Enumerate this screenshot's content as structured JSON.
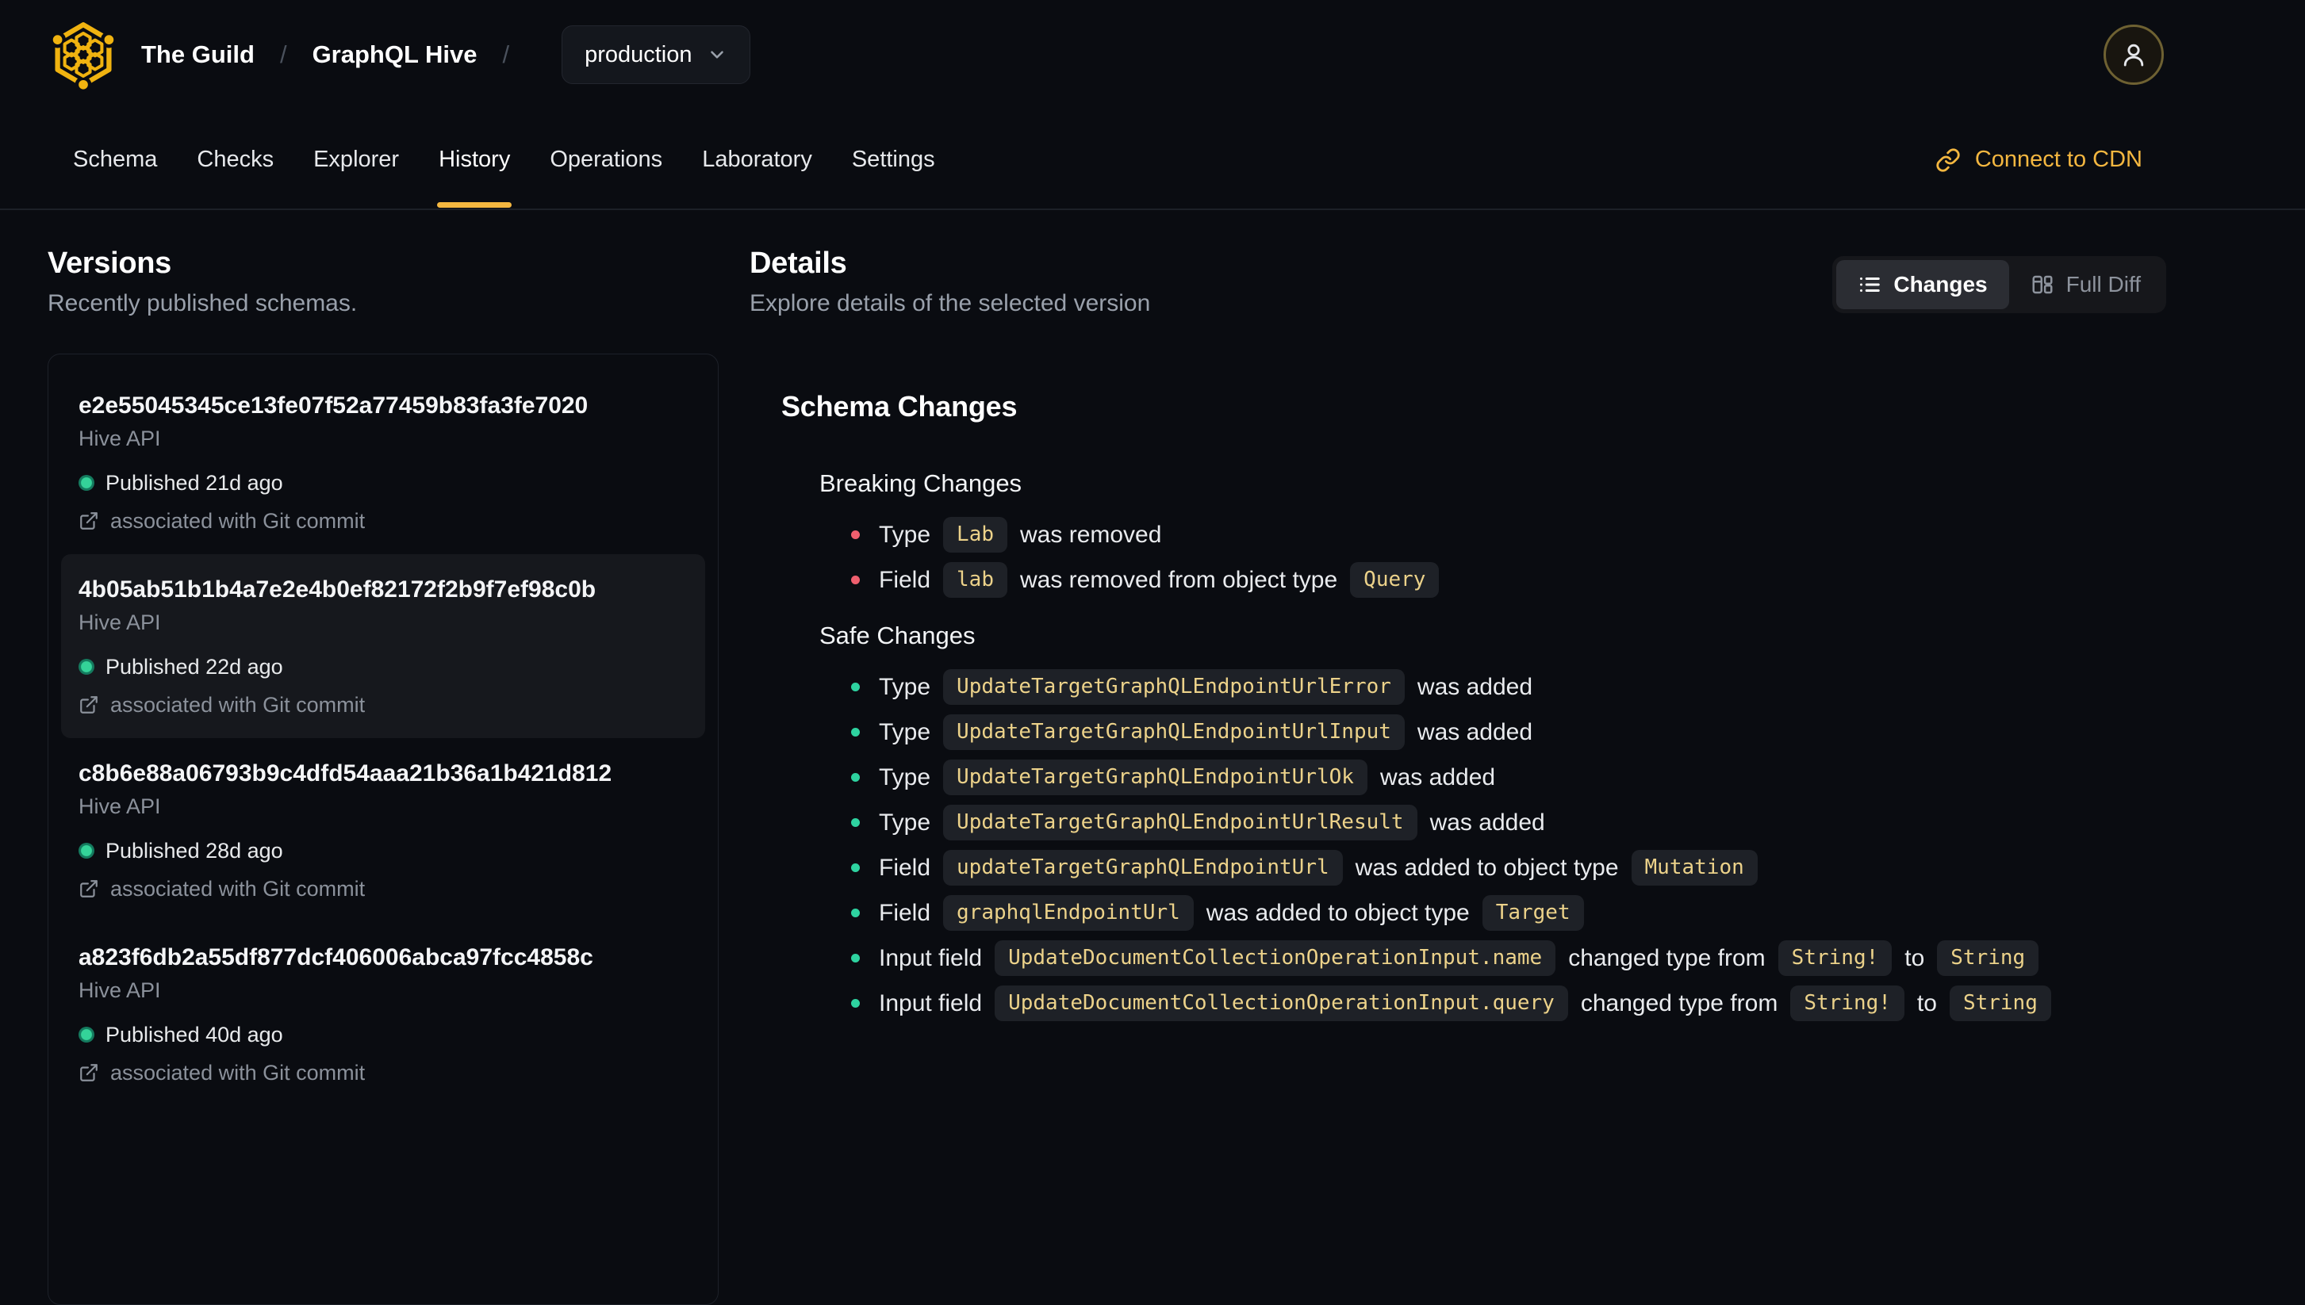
{
  "header": {
    "breadcrumb": {
      "org": "The Guild",
      "separator": "/",
      "project": "GraphQL Hive",
      "target_value": "production"
    },
    "connect_cdn_label": "Connect to CDN"
  },
  "nav": {
    "tabs": [
      "Schema",
      "Checks",
      "Explorer",
      "History",
      "Operations",
      "Laboratory",
      "Settings"
    ],
    "active_tab": "History"
  },
  "versions_panel": {
    "title": "Versions",
    "subtitle": "Recently published schemas.",
    "items": [
      {
        "hash": "e2e55045345ce13fe07f52a77459b83fa3fe7020",
        "service": "Hive API",
        "published": "Published 21d ago",
        "git_link": "associated with Git commit",
        "selected": false
      },
      {
        "hash": "4b05ab51b1b4a7e2e4b0ef82172f2b9f7ef98c0b",
        "service": "Hive API",
        "published": "Published 22d ago",
        "git_link": "associated with Git commit",
        "selected": true
      },
      {
        "hash": "c8b6e88a06793b9c4dfd54aaa21b36a1b421d812",
        "service": "Hive API",
        "published": "Published 28d ago",
        "git_link": "associated with Git commit",
        "selected": false
      },
      {
        "hash": "a823f6db2a55df877dcf406006abca97fcc4858c",
        "service": "Hive API",
        "published": "Published 40d ago",
        "git_link": "associated with Git commit",
        "selected": false
      }
    ]
  },
  "details_panel": {
    "title": "Details",
    "subtitle": "Explore details of the selected version",
    "view_toggle": {
      "changes_label": "Changes",
      "full_diff_label": "Full Diff",
      "active": "Changes"
    },
    "schema_changes": {
      "title": "Schema Changes",
      "breaking": {
        "title": "Breaking Changes",
        "items": [
          {
            "segments": [
              {
                "type": "text",
                "value": "Type"
              },
              {
                "type": "code",
                "value": "Lab"
              },
              {
                "type": "text",
                "value": "was removed"
              }
            ]
          },
          {
            "segments": [
              {
                "type": "text",
                "value": "Field"
              },
              {
                "type": "code",
                "value": "lab"
              },
              {
                "type": "text",
                "value": "was removed from object type"
              },
              {
                "type": "code",
                "value": "Query"
              }
            ]
          }
        ]
      },
      "safe": {
        "title": "Safe Changes",
        "items": [
          {
            "segments": [
              {
                "type": "text",
                "value": "Type"
              },
              {
                "type": "code",
                "value": "UpdateTargetGraphQLEndpointUrlError"
              },
              {
                "type": "text",
                "value": "was added"
              }
            ]
          },
          {
            "segments": [
              {
                "type": "text",
                "value": "Type"
              },
              {
                "type": "code",
                "value": "UpdateTargetGraphQLEndpointUrlInput"
              },
              {
                "type": "text",
                "value": "was added"
              }
            ]
          },
          {
            "segments": [
              {
                "type": "text",
                "value": "Type"
              },
              {
                "type": "code",
                "value": "UpdateTargetGraphQLEndpointUrlOk"
              },
              {
                "type": "text",
                "value": "was added"
              }
            ]
          },
          {
            "segments": [
              {
                "type": "text",
                "value": "Type"
              },
              {
                "type": "code",
                "value": "UpdateTargetGraphQLEndpointUrlResult"
              },
              {
                "type": "text",
                "value": "was added"
              }
            ]
          },
          {
            "segments": [
              {
                "type": "text",
                "value": "Field"
              },
              {
                "type": "code",
                "value": "updateTargetGraphQLEndpointUrl"
              },
              {
                "type": "text",
                "value": "was added to object type"
              },
              {
                "type": "code",
                "value": "Mutation"
              }
            ]
          },
          {
            "segments": [
              {
                "type": "text",
                "value": "Field"
              },
              {
                "type": "code",
                "value": "graphqlEndpointUrl"
              },
              {
                "type": "text",
                "value": "was added to object type"
              },
              {
                "type": "code",
                "value": "Target"
              }
            ]
          },
          {
            "segments": [
              {
                "type": "text",
                "value": "Input field"
              },
              {
                "type": "code",
                "value": "UpdateDocumentCollectionOperationInput.name"
              },
              {
                "type": "text",
                "value": "changed type from"
              },
              {
                "type": "code",
                "value": "String!"
              },
              {
                "type": "text",
                "value": "to"
              },
              {
                "type": "code",
                "value": "String"
              }
            ]
          },
          {
            "segments": [
              {
                "type": "text",
                "value": "Input field"
              },
              {
                "type": "code",
                "value": "UpdateDocumentCollectionOperationInput.query"
              },
              {
                "type": "text",
                "value": "changed type from"
              },
              {
                "type": "code",
                "value": "String!"
              },
              {
                "type": "text",
                "value": "to"
              },
              {
                "type": "code",
                "value": "String"
              }
            ]
          }
        ]
      }
    }
  },
  "icons": {
    "logo": "hive-honeycomb-logo",
    "user": "user-icon",
    "chevron": "chevron-down-icon",
    "cdn": "link-icon",
    "changes": "list-icon",
    "full_diff": "split-columns-icon",
    "git": "external-link-icon",
    "published": "published-dot"
  },
  "colors": {
    "background": "#0a0c11",
    "accent_gold": "#f4b740",
    "logo_gold": "#f0b310",
    "code_text": "#ecd28a",
    "code_badge_bg": "#1e2127",
    "breaking_bullet": "#ef5f6e",
    "safe_bullet": "#2ed3a0",
    "published_dot": "#10b981",
    "muted_text": "#8b919b",
    "selected_item_bg": "#16181d"
  }
}
